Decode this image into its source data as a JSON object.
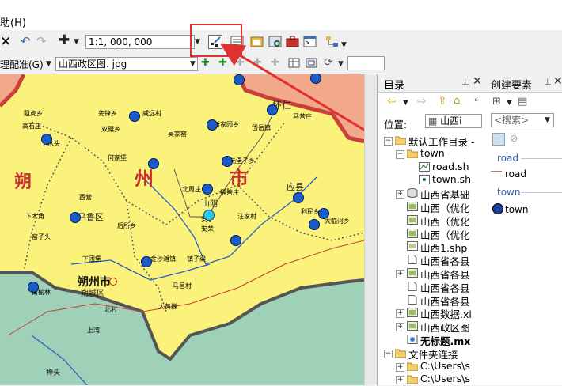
{
  "menu": {
    "help": "助(H)"
  },
  "toolbar": {
    "scale": "1:1, 000, 000"
  },
  "georef": {
    "label": "理配准(G)",
    "layer": "山西政区图. jpg",
    "value": ""
  },
  "catalog": {
    "title": "目录",
    "location_label": "位置:",
    "location_value": "山西i",
    "items": [
      "默认工作目录 -",
      "town",
      "road.sh",
      "town.sh",
      "山西省基础",
      "山西（优化",
      "山西（优化",
      "山西（优化",
      "山西1.shp",
      "山西省各县",
      "山西省各县",
      "山西省各县",
      "山西省各县",
      "山西数据.xl",
      "山西政区图",
      "无标题.mx",
      "文件夹连接",
      "C:\\Users\\s",
      "C:\\Users\\s"
    ]
  },
  "create_features": {
    "title": "创建要素",
    "search_placeholder": "<搜索>",
    "road_group": "road",
    "road_item": "road",
    "town_group": "town",
    "town_item": "town"
  },
  "map": {
    "big_labels": [
      "朔",
      "州",
      "市"
    ],
    "city": "朔州市",
    "district": "朔城区",
    "county_a": "怀仁",
    "county_b": "山阴",
    "county_c": "平鲁区",
    "county_d": "应县",
    "labels": [
      "先锋乡",
      "威远村",
      "阻虎乡",
      "双碾乡",
      "高石庄",
      "新家园乡",
      "吴家窑",
      "下水头",
      "何家堡",
      "元堡子乡",
      "北周庄",
      "岱岳镇",
      "马营庄",
      "西营",
      "福善庄",
      "后所乡",
      "安荣",
      "下木角",
      "利民乡",
      "汪家村",
      "窑子头",
      "下团堡",
      "金沙滩镇",
      "马邑村",
      "神头",
      "南榆林",
      "大黄巍",
      "安子",
      "大临河乡",
      "镇子梁",
      "北村",
      "上湾"
    ]
  },
  "colors": {
    "accent_red": "#e03030",
    "map_yellow": "#fbf27c",
    "town_blue": "#1a5bc8"
  }
}
